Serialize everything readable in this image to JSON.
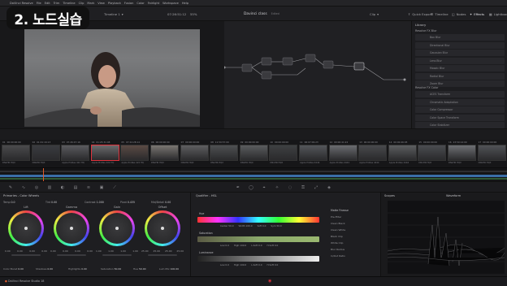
{
  "overlay_title": "2. 노드실습",
  "menubar": {
    "items": [
      "DaVinci Resolve",
      "File",
      "Edit",
      "Trim",
      "Timeline",
      "Clip",
      "Mark",
      "View",
      "Playback",
      "Fusion",
      "Color",
      "Fairlight",
      "Workspace",
      "Help"
    ]
  },
  "toolbar": {
    "project_title": "Davinci class",
    "project_status": "Edited",
    "timeline": "Timeline 1",
    "timecode_top": "07:26:51:12",
    "zoom": "55%",
    "clip_label": "Clip",
    "quick_export": "Quick Export",
    "timeline_btn": "Timeline",
    "nodes_btn": "Nodes",
    "effects_btn": "Effects",
    "lightbox_btn": "Lightbox"
  },
  "viewer": {
    "timecode": "01:00:24:14"
  },
  "library": {
    "title": "Library",
    "section1": "Resolve FX Blur",
    "blur_items": [
      "Box Blur",
      "Directional Blur",
      "Gaussian Blur",
      "Lens Blur",
      "Mosaic Blur",
      "Radial Blur",
      "Zoom Blur"
    ],
    "section2": "Resolve FX Color",
    "color_items": [
      "ACES Transform",
      "Chromatic Adaptation",
      "Color Compressor",
      "Color Space Transform",
      "Color Stabilizer",
      "Contrast Pop"
    ]
  },
  "clips": [
    {
      "num": "01",
      "tc": "00:00:00:00",
      "name": "DNxHR HQX"
    },
    {
      "num": "02",
      "tc": "01:01:16:13",
      "name": "DNxHR HQX"
    },
    {
      "num": "03",
      "tc": "07:26:47:16",
      "name": "Apple ProRes 422 HQ"
    },
    {
      "num": "04",
      "tc": "01:25:31:08",
      "name": "Apple ProRes 422 HQ"
    },
    {
      "num": "05",
      "tc": "07:24:28:14",
      "name": "Apple ProRes 422 HQ"
    },
    {
      "num": "06",
      "tc": "00:00:00:00",
      "name": "DNxHR HQX"
    },
    {
      "num": "07",
      "tc": "00:00:00:00",
      "name": "DNxHR HQX"
    },
    {
      "num": "08",
      "tc": "11:59:57:00",
      "name": "DNxHR HQX"
    },
    {
      "num": "09",
      "tc": "00:00:00:00",
      "name": "DNxHR HQX"
    },
    {
      "num": "10",
      "tc": "00:00:00:00",
      "name": "DNxHR HQX"
    },
    {
      "num": "11",
      "tc": "06:07:09:23",
      "name": "Apple ProRes 4444"
    },
    {
      "num": "12",
      "tc": "00:00:41:22",
      "name": "Apple ProRes 4444"
    },
    {
      "num": "13",
      "tc": "00:00:00:00",
      "name": "Apple ProRes 4444"
    },
    {
      "num": "14",
      "tc": "00:00:46:05",
      "name": "Apple ProRes 4444"
    },
    {
      "num": "15",
      "tc": "00:00:00:00",
      "name": "DNxHR HQX"
    },
    {
      "num": "16",
      "tc": "23:59:14:00",
      "name": "DNxHR HQX"
    },
    {
      "num": "17",
      "tc": "00:00:00:00",
      "name": "DNxHR HQX"
    }
  ],
  "wheels_panel": {
    "title": "Primaries - Color Wheels",
    "temp_label": "Temp",
    "temp_val": "0.0",
    "tint_label": "Tint",
    "tint_val": "0.00",
    "contrast_label": "Contrast",
    "contrast_val": "1.000",
    "pivot_label": "Pivot",
    "pivot_val": "0.435",
    "middetail_label": "Mid/Detail",
    "middetail_val": "0.00",
    "wheels": [
      {
        "label": "Lift",
        "values": [
          "0.00",
          "0.00",
          "0.00",
          "0.00"
        ]
      },
      {
        "label": "Gamma",
        "values": [
          "0.00",
          "0.00",
          "0.00",
          "0.00"
        ]
      },
      {
        "label": "Gain",
        "values": [
          "1.00",
          "1.00",
          "1.00",
          "1.00"
        ]
      },
      {
        "label": "Offset",
        "values": [
          "25.00",
          "25.00",
          "25.00",
          "25.00"
        ]
      }
    ],
    "colorboost_label": "Color Boost",
    "colorboost_val": "0.00",
    "shadows_label": "Shadows",
    "shadows_val": "0.00",
    "highlights_label": "Highlights",
    "highlights_val": "0.00",
    "saturation_label": "Saturation",
    "saturation_val": "50.00",
    "hue_label": "Hue",
    "hue_val": "50.00",
    "lummix_label": "Lum Mix",
    "lummix_val": "100.00"
  },
  "qualifier_panel": {
    "title": "Qualifier - HSL",
    "hue_label": "Hue",
    "sat_label": "Saturation",
    "lum_label": "Luminance",
    "hue_stats": [
      "Center 50.0",
      "Width 100.0",
      "Soft 0.0",
      "Sym 50.0"
    ],
    "sat_stats": [
      "Low 0.0",
      "High 100.0",
      "L.Soft 0.0",
      "H.Soft 0.0"
    ],
    "lum_stats": [
      "Low 0.0",
      "High 100.0",
      "L.Soft 0.0",
      "H.Soft 0.0"
    ],
    "matte_title": "Matte Finesse",
    "matte_items": [
      "Pre-Filter",
      "Clean Black",
      "Clean White",
      "Black Clip",
      "White Clip",
      "Blur Radius",
      "In/Out Ratio"
    ]
  },
  "scopes": {
    "title": "Scopes",
    "mode": "Waveform"
  },
  "status": {
    "app": "DaVinci Resolve Studio 18"
  },
  "colors": {
    "accent_red": "#e0323c",
    "playhead": "#e05a2a",
    "timeline_blue": "#3a6ea8"
  }
}
